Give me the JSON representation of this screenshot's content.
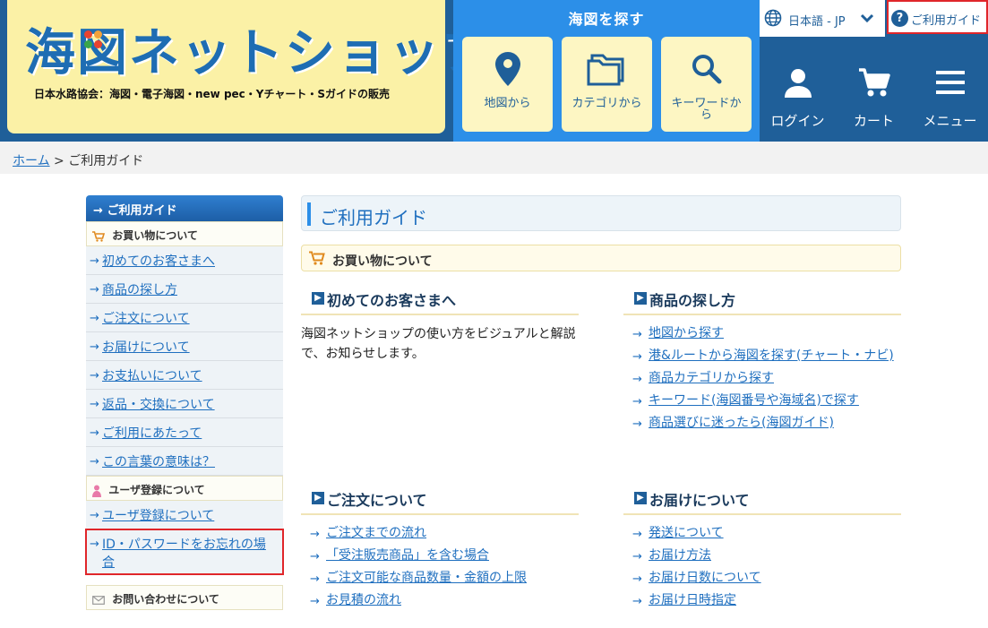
{
  "header": {
    "logo_title": "海図ネットショップ",
    "logo_subtitle": "日本水路協会：海図・電子海図・new pec・Yチャート・Sガイドの販売",
    "search_title": "海図を探す",
    "search_buttons": [
      {
        "label": "地図から",
        "icon": "map-pin-icon"
      },
      {
        "label": "カテゴリから",
        "icon": "folder-icon"
      },
      {
        "label": "キーワードから",
        "icon": "search-icon"
      }
    ],
    "language": "日本語 - JP",
    "guide_label": "ご利用ガイド",
    "user_buttons": [
      {
        "label": "ログイン",
        "icon": "user-icon"
      },
      {
        "label": "カート",
        "icon": "cart-icon"
      },
      {
        "label": "メニュー",
        "icon": "menu-icon"
      }
    ]
  },
  "breadcrumb": {
    "home": "ホーム",
    "separator": ">",
    "current": "ご利用ガイド"
  },
  "sidebar": {
    "title": "ご利用ガイド",
    "sections": [
      {
        "title": "お買い物について",
        "items": [
          "初めてのお客さまへ",
          "商品の探し方",
          "ご注文について",
          "お届けについて",
          "お支払いについて",
          "返品・交換について",
          "ご利用にあたって",
          "この言葉の意味は？"
        ]
      },
      {
        "title": "ユーザ登録について",
        "items": [
          "ユーザ登録について",
          "ID・パスワードをお忘れの場合"
        ]
      },
      {
        "title": "お問い合わせについて",
        "items": []
      }
    ]
  },
  "main": {
    "title": "ご利用ガイド",
    "subtitle": "お買い物について",
    "blocks": [
      {
        "title": "初めてのお客さまへ",
        "desc": "海図ネットショップの使い方をビジュアルと解説で、お知らせします。",
        "links": []
      },
      {
        "title": "商品の探し方",
        "desc": "",
        "links": [
          "地図から探す",
          "港&ルートから海図を探す(チャート・ナビ)",
          "商品カテゴリから探す",
          "キーワード(海図番号や海域名)で探す",
          "商品選びに迷ったら(海図ガイド)"
        ]
      },
      {
        "title": "ご注文について",
        "desc": "",
        "links": [
          "ご注文までの流れ",
          "「受注販売商品」を含む場合",
          "ご注文可能な商品数量・金額の上限",
          "お見積の流れ"
        ]
      },
      {
        "title": "お届けについて",
        "desc": "",
        "links": [
          "発送について",
          "お届け方法",
          "お届け日数について",
          "お届け日時指定"
        ]
      }
    ]
  },
  "colors": {
    "header_bg": "#1f5f99",
    "search_bg": "#2c8fe8",
    "logo_bg": "#fbf1a6",
    "link": "#1f6fbf",
    "highlight": "#e0262a"
  }
}
